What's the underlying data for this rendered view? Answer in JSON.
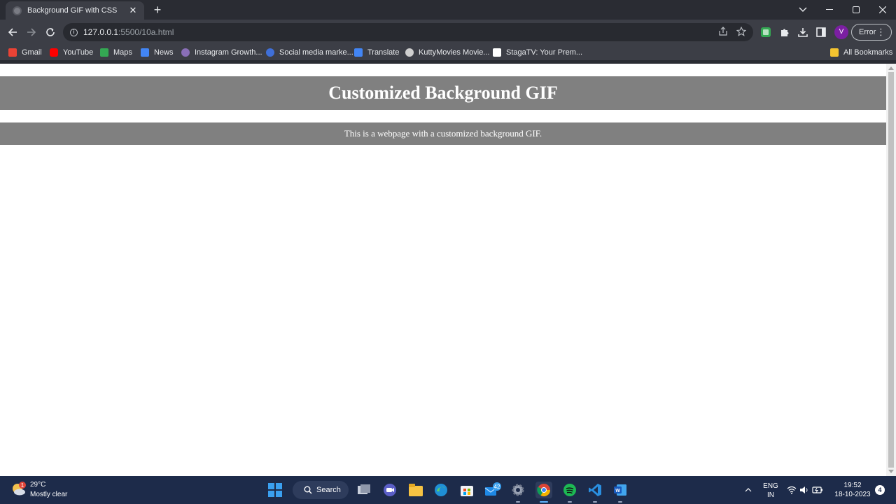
{
  "browser": {
    "tab": {
      "title": "Background GIF with CSS",
      "close": "✕"
    },
    "new_tab": "+",
    "window_controls": {
      "dropdown": "⌄",
      "minimize": "—",
      "maximize": "▢",
      "close": "✕"
    },
    "omnibox": {
      "host": "127.0.0.1",
      "path": ":5500/10a.html"
    },
    "profile_initial": "V",
    "error_label": "Error",
    "menu_dots": "⋮"
  },
  "bookmarks": [
    {
      "label": "Gmail",
      "icon": "gmail-icon",
      "color": "#ea4335"
    },
    {
      "label": "YouTube",
      "icon": "youtube-icon",
      "color": "#ff0000"
    },
    {
      "label": "Maps",
      "icon": "maps-icon",
      "color": "#34a853"
    },
    {
      "label": "News",
      "icon": "news-icon",
      "color": "#4285f4"
    },
    {
      "label": "Instagram Growth...",
      "icon": "instagram-icon",
      "color": "#8a6fb8"
    },
    {
      "label": "Social media marke...",
      "icon": "globe-icon",
      "color": "#3f6fd8"
    },
    {
      "label": "Translate",
      "icon": "translate-icon",
      "color": "#4285f4"
    },
    {
      "label": "KuttyMovies Movie...",
      "icon": "film-icon",
      "color": "#cfcfcf"
    },
    {
      "label": "StagaTV: Your Prem...",
      "icon": "stagatv-icon",
      "color": "#ffffff"
    }
  ],
  "all_bookmarks": "All Bookmarks",
  "page": {
    "heading": "Customized Background GIF",
    "paragraph": "This is a webpage with a customized background GIF.",
    "band_color": "#808080"
  },
  "taskbar": {
    "weather": {
      "temp": "29°C",
      "desc": "Mostly clear",
      "badge": "1"
    },
    "search_label": "Search",
    "mail_badge": "42",
    "lang_top": "ENG",
    "lang_bottom": "IN",
    "time": "19:52",
    "date": "18-10-2023",
    "notifications": "4",
    "accent": "#1d2b4a"
  }
}
